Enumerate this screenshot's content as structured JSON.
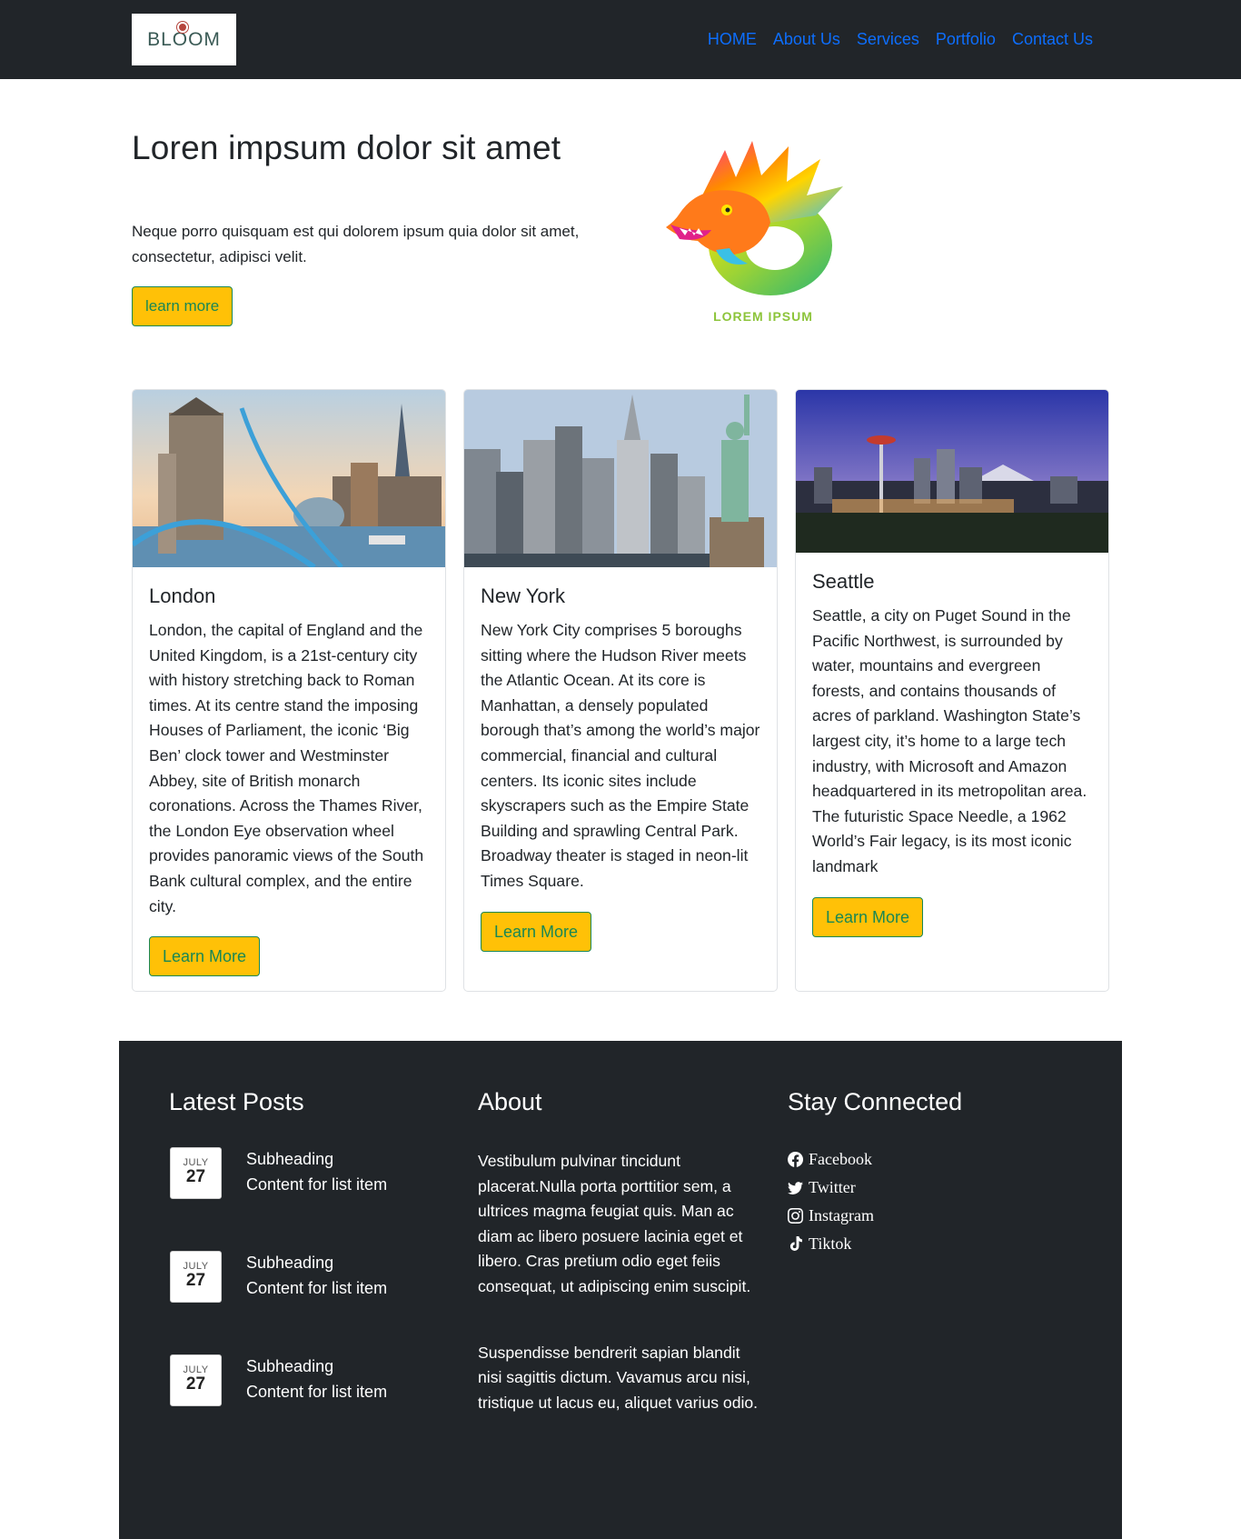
{
  "nav": {
    "logo_text": "BLOOM",
    "links": [
      "HOME",
      "About Us",
      "Services",
      "Portfolio",
      "Contact Us"
    ]
  },
  "hero": {
    "title": "Loren impsum dolor sit amet",
    "text": "Neque porro quisquam est qui dolorem ipsum quia dolor sit amet, consectetur, adipisci velit.",
    "button": "learn more",
    "logo_text": "LOREM IPSUM"
  },
  "cards": [
    {
      "title": "London",
      "text": "London, the capital of England and the United Kingdom, is a 21st-century city with history stretching back to Roman times. At its centre stand the imposing Houses of Parliament, the iconic ‘Big Ben’ clock tower and Westminster Abbey, site of British monarch coronations. Across the Thames River, the London Eye observation wheel provides panoramic views of the South Bank cultural complex, and the entire city.",
      "button": "Learn More"
    },
    {
      "title": "New York",
      "text": "New York City comprises 5 boroughs sitting where the Hudson River meets the Atlantic Ocean. At its core is Manhattan, a densely populated borough that’s among the world’s major commercial, financial and cultural centers. Its iconic sites include skyscrapers such as the Empire State Building and sprawling Central Park. Broadway theater is staged in neon-lit Times Square.",
      "button": "Learn More"
    },
    {
      "title": "Seattle",
      "text": "Seattle, a city on Puget Sound in the Pacific Northwest, is surrounded by water, mountains and evergreen forests, and contains thousands of acres of parkland. Washington State’s largest city, it’s home to a large tech industry, with Microsoft and Amazon headquartered in its metropolitan area. The futuristic Space Needle, a 1962 World’s Fair legacy, is its most iconic landmark",
      "button": "Learn More"
    }
  ],
  "footer": {
    "posts_title": "Latest Posts",
    "posts": [
      {
        "month": "JULY",
        "day": "27",
        "subheading": "Subheading",
        "content": "Content for list item"
      },
      {
        "month": "JULY",
        "day": "27",
        "subheading": "Subheading",
        "content": "Content for list item"
      },
      {
        "month": "JULY",
        "day": "27",
        "subheading": "Subheading",
        "content": "Content for list item"
      }
    ],
    "about_title": "About",
    "about_p1": "Vestibulum pulvinar tincidunt placerat.Nulla porta porttitior sem, a ultrices magma feugiat quis. Man ac diam ac libero posuere lacinia eget et libero. Cras pretium odio eget feiis consequat, ut adipiscing enim suscipit.",
    "about_p2": "Suspendisse bendrerit sapian blandit nisi sagittis dictum. Vavamus arcu nisi, tristique ut lacus eu, aliquet varius odio.",
    "social_title": "Stay Connected",
    "social": [
      {
        "icon": "facebook-icon",
        "label": "Facebook"
      },
      {
        "icon": "twitter-icon",
        "label": "Twitter"
      },
      {
        "icon": "instagram-icon",
        "label": "Instagram"
      },
      {
        "icon": "tiktok-icon",
        "label": "Tiktok"
      }
    ]
  },
  "colors": {
    "navbar_bg": "#212529",
    "link": "#0d6efd",
    "button_bg": "#ffc107",
    "button_text": "#198754"
  }
}
